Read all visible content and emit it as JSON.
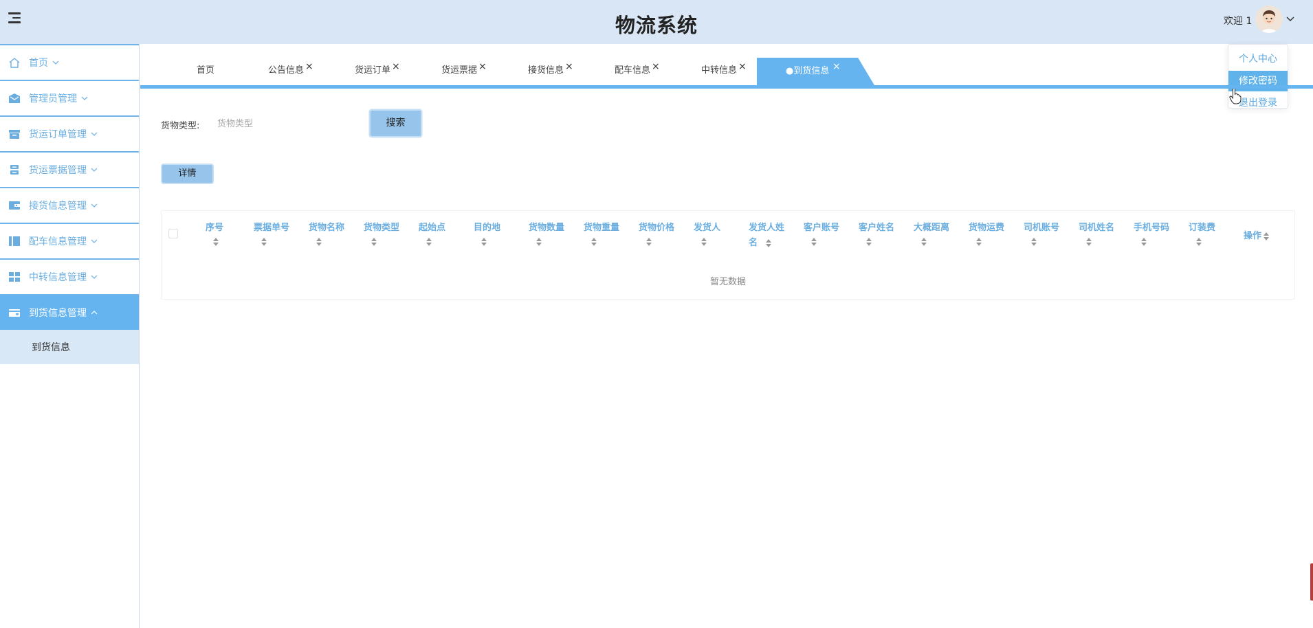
{
  "header": {
    "title": "物流系统",
    "welcome": "欢迎 1",
    "menu_icon": "hamburger-icon",
    "avatar_icon": "user-avatar",
    "chevron_icon": "chevron-down-icon"
  },
  "user_menu": {
    "items": [
      {
        "label": "个人中心",
        "active": false
      },
      {
        "label": "修改密码",
        "active": true
      },
      {
        "label": "退出登录",
        "active": false
      }
    ]
  },
  "sidebar": {
    "items": [
      {
        "label": "首页",
        "icon": "home-icon",
        "expanded": false
      },
      {
        "label": "管理员管理",
        "icon": "mail-icon",
        "expanded": false
      },
      {
        "label": "货运订单管理",
        "icon": "box-icon",
        "expanded": false
      },
      {
        "label": "货运票据管理",
        "icon": "server-icon",
        "expanded": false
      },
      {
        "label": "接货信息管理",
        "icon": "wallet-icon",
        "expanded": false
      },
      {
        "label": "配车信息管理",
        "icon": "columns-icon",
        "expanded": false
      },
      {
        "label": "中转信息管理",
        "icon": "grid-icon",
        "expanded": false
      },
      {
        "label": "到货信息管理",
        "icon": "card-icon",
        "expanded": true
      }
    ],
    "subitem": "到货信息"
  },
  "tabs": {
    "items": [
      "首页",
      "公告信息",
      "货运订单",
      "货运票据",
      "接货信息",
      "配车信息",
      "中转信息"
    ],
    "active": "●到货信息",
    "close_symbol": "×"
  },
  "search": {
    "label": "货物类型:",
    "placeholder": "货物类型",
    "button": "搜索"
  },
  "actions": {
    "detail": "详情"
  },
  "table": {
    "columns": [
      "序号",
      "票据单号",
      "货物名称",
      "货物类型",
      "起始点",
      "目的地",
      "货物数量",
      "货物重量",
      "货物价格",
      "发货人",
      "发货人姓名",
      "客户账号",
      "客户姓名",
      "大概距离",
      "货物运费",
      "司机账号",
      "司机姓名",
      "手机号码",
      "订装费",
      "操作"
    ],
    "empty_text": "暂无数据"
  },
  "colors": {
    "header_bg": "#d9e6f5",
    "accent": "#65b3ef",
    "link": "#6aaee0"
  }
}
